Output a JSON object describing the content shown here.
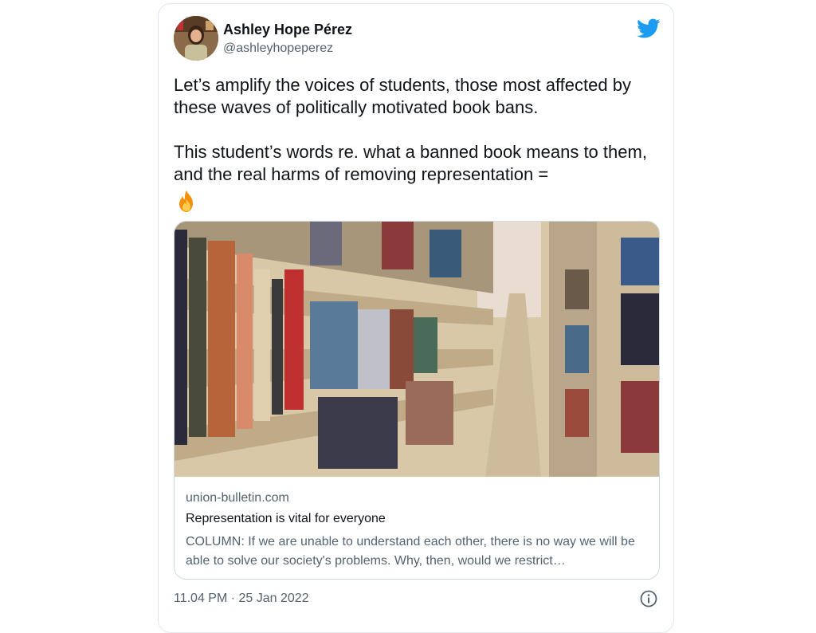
{
  "tweet": {
    "author_name": "Ashley Hope Pérez",
    "author_handle": "@ashleyhopeperez",
    "text": "Let’s amplify the voices of students, those most affected by these waves of politically motivated book bans.\n\nThis student’s words re. what a banned book means to them, and the real harms of removing representation =",
    "emoji": "fire-emoji",
    "timestamp": "11.04 PM · 25 Jan 2022"
  },
  "card": {
    "domain": "union-bulletin.com",
    "title": "Representation is vital for everyone",
    "description": "COLUMN: If we are unable to understand each other, there is no way we will be able to solve our society's problems. Why, then, would we restrict…",
    "image": "library-bookshelves-photo"
  },
  "icons": {
    "logo": "twitter-bird-icon",
    "info": "info-icon"
  },
  "colors": {
    "brand": "#1d9bf0",
    "secondary_text": "#536471",
    "border": "#cfd9de"
  }
}
